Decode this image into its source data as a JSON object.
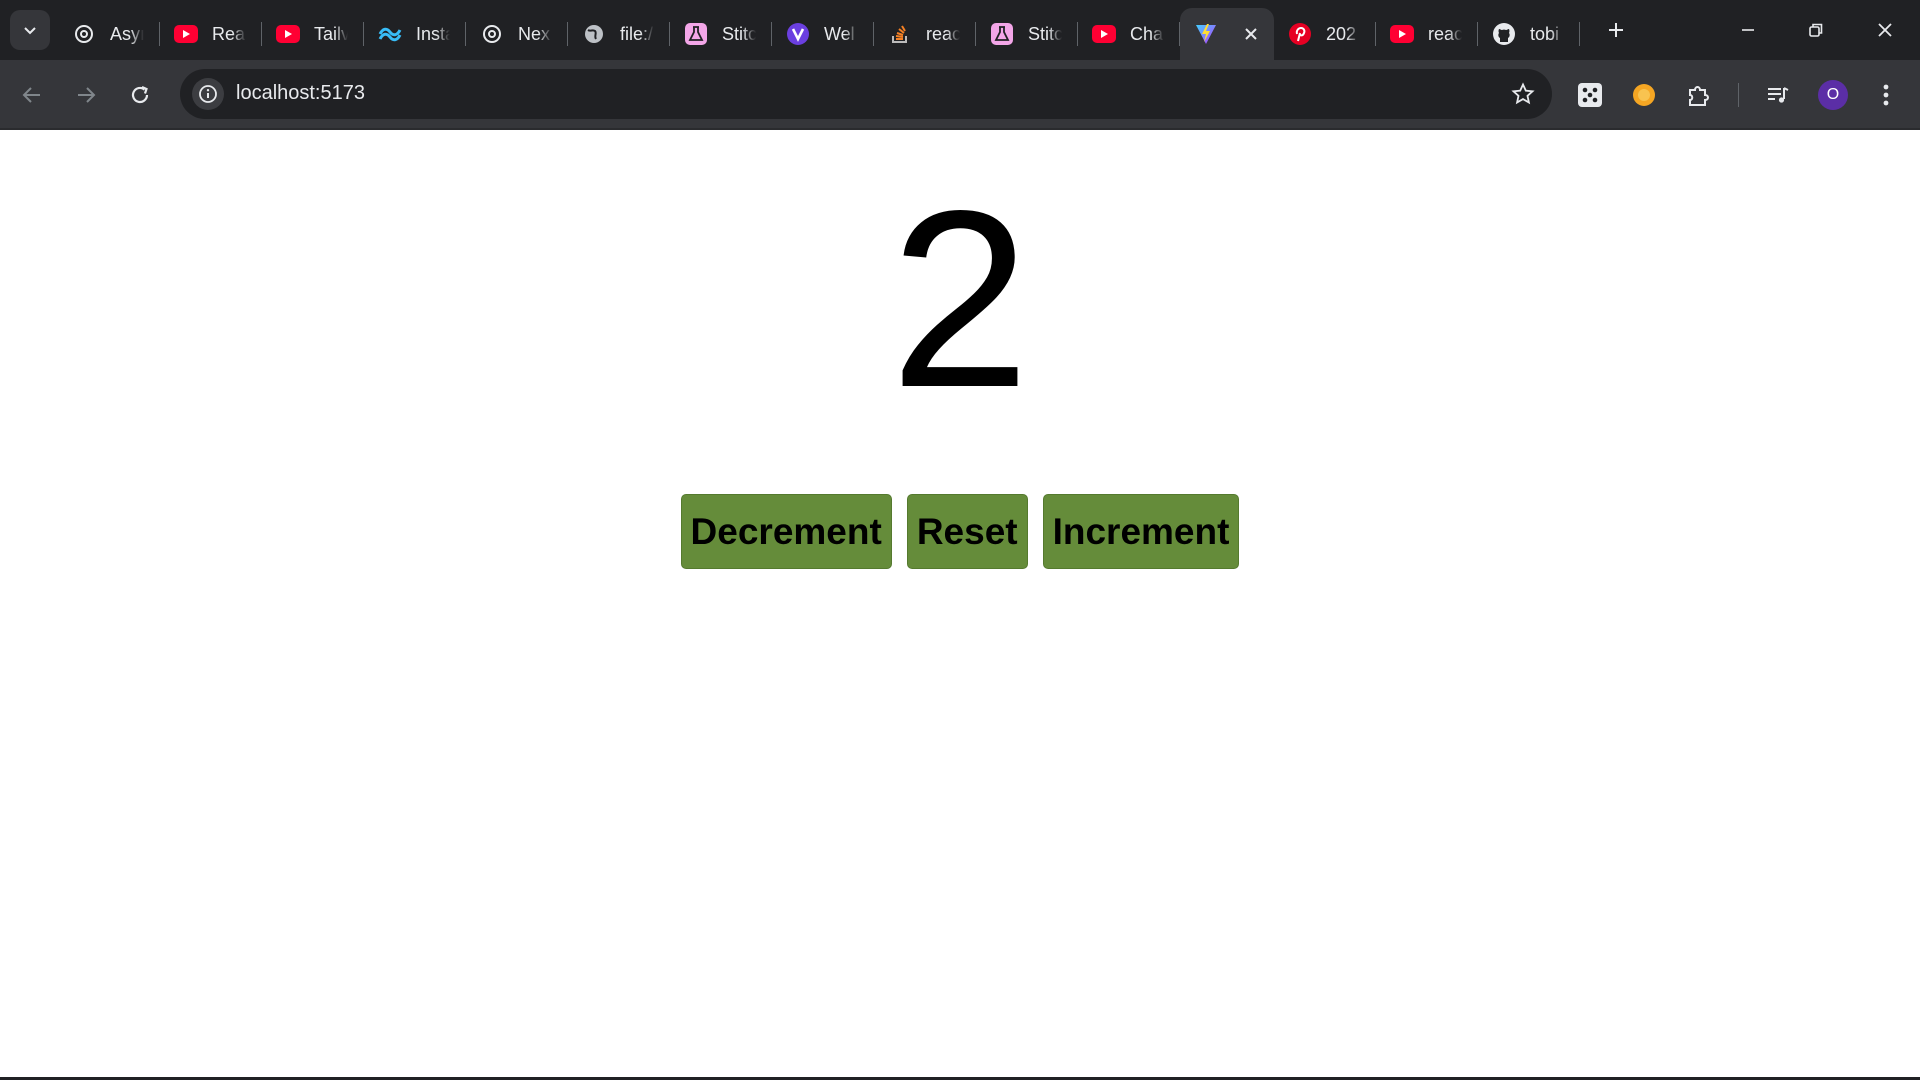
{
  "browser": {
    "tabs": [
      {
        "title": "Asyı",
        "icon": "openai-icon"
      },
      {
        "title": "Rea",
        "icon": "youtube-icon"
      },
      {
        "title": "Tailv",
        "icon": "youtube-icon"
      },
      {
        "title": "Insta",
        "icon": "tailwind-icon"
      },
      {
        "title": "Nex",
        "icon": "openai-icon"
      },
      {
        "title": "file:/",
        "icon": "globe-icon"
      },
      {
        "title": "Stitc",
        "icon": "flask-icon"
      },
      {
        "title": "Wel",
        "icon": "vercel-v-icon"
      },
      {
        "title": "reac",
        "icon": "stackoverflow-icon"
      },
      {
        "title": "Stitc",
        "icon": "flask-icon"
      },
      {
        "title": "Cha",
        "icon": "youtube-icon"
      },
      {
        "title": "",
        "icon": "vite-icon",
        "active": true
      },
      {
        "title": "202",
        "icon": "pinterest-icon"
      },
      {
        "title": "reac",
        "icon": "youtube-icon"
      },
      {
        "title": "tobi",
        "icon": "github-icon"
      }
    ],
    "address": {
      "url": "localhost:5173"
    },
    "profile": {
      "initial": "O",
      "color": "#5b2ea6"
    }
  },
  "app": {
    "count": "2",
    "buttons": {
      "decrement": "Decrement",
      "reset": "Reset",
      "increment": "Increment"
    },
    "button_color": "#658c3a"
  }
}
